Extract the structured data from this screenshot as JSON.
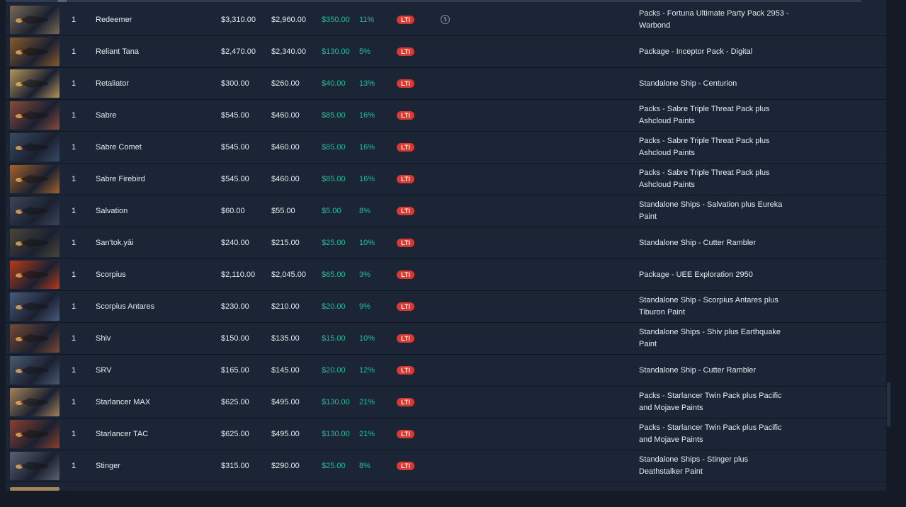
{
  "badge": {
    "lti": "LTI"
  },
  "coin": {
    "symbol": "$"
  },
  "rows": [
    {
      "qty": "1",
      "name": "Redeemer",
      "msrp": "$3,310.00",
      "melt": "$2,960.00",
      "savings": "$350.00",
      "pct": "11%",
      "source": "Packs - Fortuna Ultimate Party Pack 2953 - Warbond",
      "thumb_color": "#7a6a55"
    },
    {
      "qty": "1",
      "name": "Reliant Tana",
      "msrp": "$2,470.00",
      "melt": "$2,340.00",
      "savings": "$130.00",
      "pct": "5%",
      "source": "Package - Inceptor Pack - Digital",
      "thumb_color": "#8a5a2a"
    },
    {
      "qty": "1",
      "name": "Retaliator",
      "msrp": "$300.00",
      "melt": "$260.00",
      "savings": "$40.00",
      "pct": "13%",
      "source": "Standalone Ship - Centurion",
      "thumb_color": "#b4955a"
    },
    {
      "qty": "1",
      "name": "Sabre",
      "msrp": "$545.00",
      "melt": "$460.00",
      "savings": "$85.00",
      "pct": "16%",
      "source": "Packs - Sabre Triple Threat Pack plus Ashcloud Paints",
      "thumb_color": "#8a4a3a"
    },
    {
      "qty": "1",
      "name": "Sabre Comet",
      "msrp": "$545.00",
      "melt": "$460.00",
      "savings": "$85.00",
      "pct": "16%",
      "source": "Packs - Sabre Triple Threat Pack plus Ashcloud Paints",
      "thumb_color": "#3a4a62"
    },
    {
      "qty": "1",
      "name": "Sabre Firebird",
      "msrp": "$545.00",
      "melt": "$460.00",
      "savings": "$85.00",
      "pct": "16%",
      "source": "Packs - Sabre Triple Threat Pack plus Ashcloud Paints",
      "thumb_color": "#a4632a"
    },
    {
      "qty": "1",
      "name": "Salvation",
      "msrp": "$60.00",
      "melt": "$55.00",
      "savings": "$5.00",
      "pct": "8%",
      "source": "Standalone Ships - Salvation plus Eureka Paint",
      "thumb_color": "#3c4658"
    },
    {
      "qty": "1",
      "name": "San'tok.yāi",
      "msrp": "$240.00",
      "melt": "$215.00",
      "savings": "$25.00",
      "pct": "10%",
      "source": "Standalone Ship - Cutter Rambler",
      "thumb_color": "#4a4638"
    },
    {
      "qty": "1",
      "name": "Scorpius",
      "msrp": "$2,110.00",
      "melt": "$2,045.00",
      "savings": "$65.00",
      "pct": "3%",
      "source": "Package - UEE Exploration 2950",
      "thumb_color": "#b83a1a"
    },
    {
      "qty": "1",
      "name": "Scorpius Antares",
      "msrp": "$230.00",
      "melt": "$210.00",
      "savings": "$20.00",
      "pct": "9%",
      "source": "Standalone Ship - Scorpius Antares plus Tiburon Paint",
      "thumb_color": "#4a5a7a"
    },
    {
      "qty": "1",
      "name": "Shiv",
      "msrp": "$150.00",
      "melt": "$135.00",
      "savings": "$15.00",
      "pct": "10%",
      "source": "Standalone Ships - Shiv plus Earthquake Paint",
      "thumb_color": "#7a4a32"
    },
    {
      "qty": "1",
      "name": "SRV",
      "msrp": "$165.00",
      "melt": "$145.00",
      "savings": "$20.00",
      "pct": "12%",
      "source": "Standalone Ship - Cutter Rambler",
      "thumb_color": "#4a5a72"
    },
    {
      "qty": "1",
      "name": "Starlancer MAX",
      "msrp": "$625.00",
      "melt": "$495.00",
      "savings": "$130.00",
      "pct": "21%",
      "source": "Packs - Starlancer Twin Pack plus Pacific and Mojave Paints",
      "thumb_color": "#a4825a"
    },
    {
      "qty": "1",
      "name": "Starlancer TAC",
      "msrp": "$625.00",
      "melt": "$495.00",
      "savings": "$130.00",
      "pct": "21%",
      "source": "Packs - Starlancer Twin Pack plus Pacific and Mojave Paints",
      "thumb_color": "#8a4030"
    },
    {
      "qty": "1",
      "name": "Stinger",
      "msrp": "$315.00",
      "melt": "$290.00",
      "savings": "$25.00",
      "pct": "8%",
      "source": "Standalone Ships - Stinger plus Deathstalker Paint",
      "thumb_color": "#5a6272"
    }
  ]
}
